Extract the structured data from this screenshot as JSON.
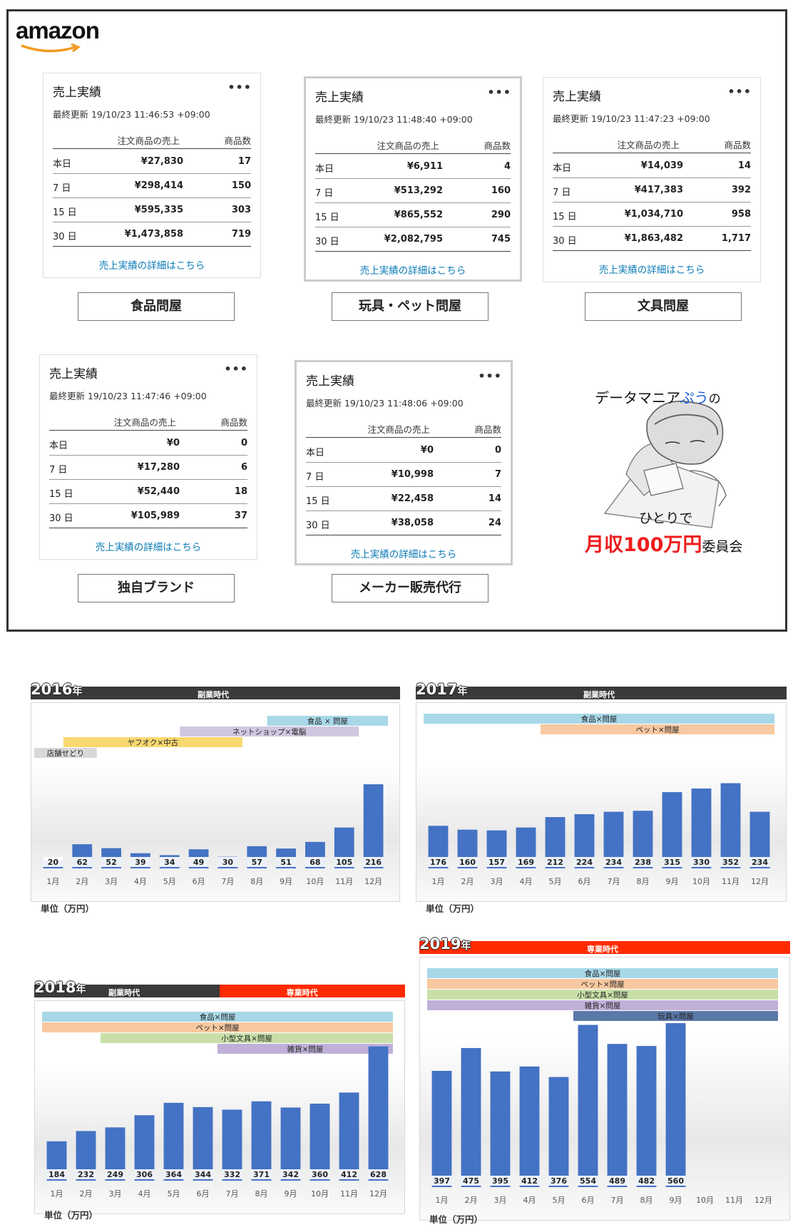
{
  "brand": {
    "logo_text": "amazon"
  },
  "cards": [
    {
      "title": "売上実績",
      "updated": "最終更新 19/10/23 11:46:53 +09:00",
      "col_sales": "注文商品の売上",
      "col_units": "商品数",
      "rows": [
        {
          "period": "本日",
          "sales": "¥27,830",
          "units": "17"
        },
        {
          "period": "7 日",
          "sales": "¥298,414",
          "units": "150"
        },
        {
          "period": "15 日",
          "sales": "¥595,335",
          "units": "303"
        },
        {
          "period": "30 日",
          "sales": "¥1,473,858",
          "units": "719"
        }
      ],
      "link": "売上実績の詳細はこちら",
      "category": "食品問屋"
    },
    {
      "title": "売上実績",
      "updated": "最終更新 19/10/23 11:48:40 +09:00",
      "col_sales": "注文商品の売上",
      "col_units": "商品数",
      "rows": [
        {
          "period": "本日",
          "sales": "¥6,911",
          "units": "4"
        },
        {
          "period": "7 日",
          "sales": "¥513,292",
          "units": "160"
        },
        {
          "period": "15 日",
          "sales": "¥865,552",
          "units": "290"
        },
        {
          "period": "30 日",
          "sales": "¥2,082,795",
          "units": "745"
        }
      ],
      "link": "売上実績の詳細はこちら",
      "category": "玩具・ペット問屋"
    },
    {
      "title": "売上実績",
      "updated": "最終更新 19/10/23 11:47:23 +09:00",
      "col_sales": "注文商品の売上",
      "col_units": "商品数",
      "rows": [
        {
          "period": "本日",
          "sales": "¥14,039",
          "units": "14"
        },
        {
          "period": "7 日",
          "sales": "¥417,383",
          "units": "392"
        },
        {
          "period": "15 日",
          "sales": "¥1,034,710",
          "units": "958"
        },
        {
          "period": "30 日",
          "sales": "¥1,863,482",
          "units": "1,717"
        }
      ],
      "link": "売上実績の詳細はこちら",
      "category": "文具問屋"
    },
    {
      "title": "売上実績",
      "updated": "最終更新 19/10/23 11:47:46 +09:00",
      "col_sales": "注文商品の売上",
      "col_units": "商品数",
      "rows": [
        {
          "period": "本日",
          "sales": "¥0",
          "units": "0"
        },
        {
          "period": "7 日",
          "sales": "¥17,280",
          "units": "6"
        },
        {
          "period": "15 日",
          "sales": "¥52,440",
          "units": "18"
        },
        {
          "period": "30 日",
          "sales": "¥105,989",
          "units": "37"
        }
      ],
      "link": "売上実績の詳細はこちら",
      "category": "独自ブランド"
    },
    {
      "title": "売上実績",
      "updated": "最終更新 19/10/23 11:48:06 +09:00",
      "col_sales": "注文商品の売上",
      "col_units": "商品数",
      "rows": [
        {
          "period": "本日",
          "sales": "¥0",
          "units": "0"
        },
        {
          "period": "7 日",
          "sales": "¥10,998",
          "units": "7"
        },
        {
          "period": "15 日",
          "sales": "¥22,458",
          "units": "14"
        },
        {
          "period": "30 日",
          "sales": "¥38,058",
          "units": "24"
        }
      ],
      "link": "売上実績の詳細はこちら",
      "category": "メーカー販売代行"
    }
  ],
  "promo": {
    "line1_a": "データマニア",
    "line1_b": "ぷう",
    "line1_c": "の",
    "line2": "ひとりで",
    "line3_a": "月収100万円",
    "line3_b": "委員会"
  },
  "colors": {
    "bar": "#4472c4",
    "side_job": "#3a3a3a",
    "full_time": "#ff2a00",
    "food": "#a8d8e8",
    "pet": "#f8c8a0",
    "stationery": "#c8e0a8",
    "goods": "#c0b0d8",
    "yahoo": "#f8d870",
    "netshop": "#d0c8e0",
    "store": "#d8d8d8"
  },
  "chart_data": [
    {
      "type": "bar",
      "year": "2016",
      "year_suffix": "年",
      "period_labels": [
        "副業時代"
      ],
      "unit": "単位（万円）",
      "categories": [
        "1月",
        "2月",
        "3月",
        "4月",
        "5月",
        "6月",
        "7月",
        "8月",
        "9月",
        "10月",
        "11月",
        "12月"
      ],
      "values": [
        20,
        62,
        52,
        39,
        34,
        49,
        30,
        57,
        51,
        68,
        105,
        216
      ],
      "annotations": [
        {
          "label": "店舗せどり",
          "from": 1,
          "to": 2,
          "color": "store"
        },
        {
          "label": "ヤフオク×中古",
          "from": 2,
          "to": 7,
          "color": "yahoo"
        },
        {
          "label": "ネットショップ×電脳",
          "from": 6,
          "to": 11,
          "color": "netshop"
        },
        {
          "label": "食品 × 問屋",
          "from": 9,
          "to": 12,
          "color": "food"
        }
      ]
    },
    {
      "type": "bar",
      "year": "2017",
      "year_suffix": "年",
      "period_labels": [
        "副業時代"
      ],
      "unit": "単位（万円）",
      "categories": [
        "1月",
        "2月",
        "3月",
        "4月",
        "5月",
        "6月",
        "7月",
        "8月",
        "9月",
        "10月",
        "11月",
        "12月"
      ],
      "values": [
        176,
        160,
        157,
        169,
        212,
        224,
        234,
        238,
        315,
        330,
        352,
        234
      ],
      "annotations": [
        {
          "label": "食品×問屋",
          "from": 1,
          "to": 12,
          "color": "food"
        },
        {
          "label": "ペット×問屋",
          "from": 5,
          "to": 12,
          "color": "pet"
        }
      ]
    },
    {
      "type": "bar",
      "year": "2018",
      "year_suffix": "年",
      "period_labels": [
        "副業時代",
        "専業時代"
      ],
      "unit": "単位（万円）",
      "categories": [
        "1月",
        "2月",
        "3月",
        "4月",
        "5月",
        "6月",
        "7月",
        "8月",
        "9月",
        "10月",
        "11月",
        "12月"
      ],
      "values": [
        184,
        232,
        249,
        306,
        364,
        344,
        332,
        371,
        342,
        360,
        412,
        628
      ],
      "annotations": [
        {
          "label": "食品×問屋",
          "from": 1,
          "to": 12,
          "color": "food"
        },
        {
          "label": "ペット×問屋",
          "from": 1,
          "to": 12,
          "color": "pet"
        },
        {
          "label": "小型文具×問屋",
          "from": 3,
          "to": 12,
          "color": "stationery"
        },
        {
          "label": "雑貨×問屋",
          "from": 7,
          "to": 12,
          "color": "goods"
        }
      ]
    },
    {
      "type": "bar",
      "year": "2019",
      "year_suffix": "年",
      "period_labels": [
        "専業時代"
      ],
      "unit": "単位（万円）",
      "categories": [
        "1月",
        "2月",
        "3月",
        "4月",
        "5月",
        "6月",
        "7月",
        "8月",
        "9月",
        "10月",
        "11月",
        "12月"
      ],
      "values": [
        397,
        475,
        395,
        412,
        376,
        554,
        489,
        482,
        560,
        null,
        null,
        null
      ],
      "annotations": [
        {
          "label": "食品×問屋",
          "from": 1,
          "to": 12,
          "color": "food"
        },
        {
          "label": "ペット×問屋",
          "from": 1,
          "to": 12,
          "color": "pet"
        },
        {
          "label": "小型文具×問屋",
          "from": 1,
          "to": 12,
          "color": "stationery"
        },
        {
          "label": "雑貨×問屋",
          "from": 1,
          "to": 12,
          "color": "goods"
        },
        {
          "label": "玩具×問屋",
          "from": 6,
          "to": 12,
          "color": "toy"
        }
      ]
    }
  ]
}
